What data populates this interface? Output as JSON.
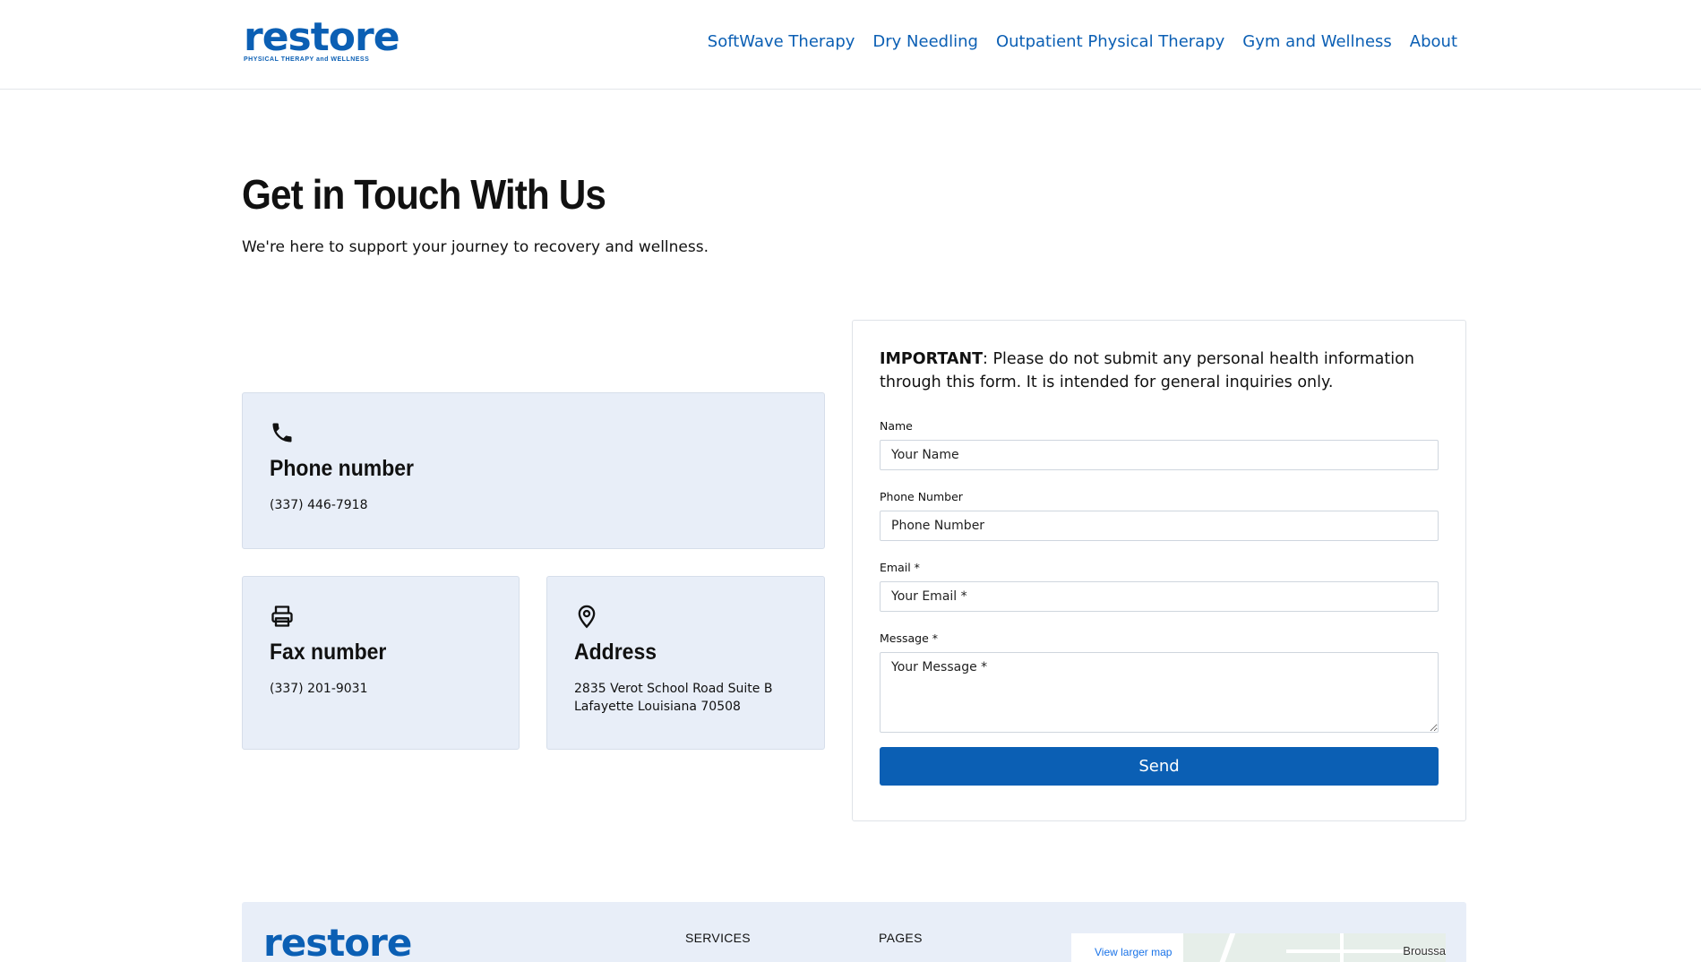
{
  "header": {
    "logo_word": "restore",
    "logo_tagline": "PHYSICAL THERAPY and WELLNESS",
    "nav": [
      {
        "label": "SoftWave Therapy"
      },
      {
        "label": "Dry Needling"
      },
      {
        "label": "Outpatient Physical Therapy"
      },
      {
        "label": "Gym and Wellness"
      },
      {
        "label": "About"
      }
    ]
  },
  "hero": {
    "title": "Get in Touch With Us",
    "subtitle": "We're here to support your journey to recovery and wellness."
  },
  "cards": {
    "phone": {
      "title": "Phone number",
      "value": "(337) 446-7918",
      "icon": "phone-icon"
    },
    "fax": {
      "title": "Fax number",
      "value": "(337) 201-9031",
      "icon": "printer-icon"
    },
    "address": {
      "title": "Address",
      "line1": "2835 Verot School Road Suite B",
      "line2": "Lafayette Louisiana 70508",
      "icon": "location-pin-icon"
    }
  },
  "form": {
    "notice_bold": "IMPORTANT",
    "notice_text": ": Please do not submit any personal health information through this form. It is intended for general inquiries only.",
    "name_label": "Name",
    "name_placeholder": "Your Name",
    "phone_label": "Phone Number",
    "phone_placeholder": "Phone Number",
    "email_label": "Email *",
    "email_placeholder": "Your Email *",
    "message_label": "Message *",
    "message_placeholder": "Your Message *",
    "send_label": "Send"
  },
  "footer": {
    "logo_word": "restore",
    "services_heading": "SERVICES",
    "pages_heading": "PAGES",
    "map_link": "View larger map",
    "map_place": "Broussa"
  },
  "colors": {
    "brand_blue": "#0b5fb4",
    "card_bg": "#e8eef8"
  }
}
